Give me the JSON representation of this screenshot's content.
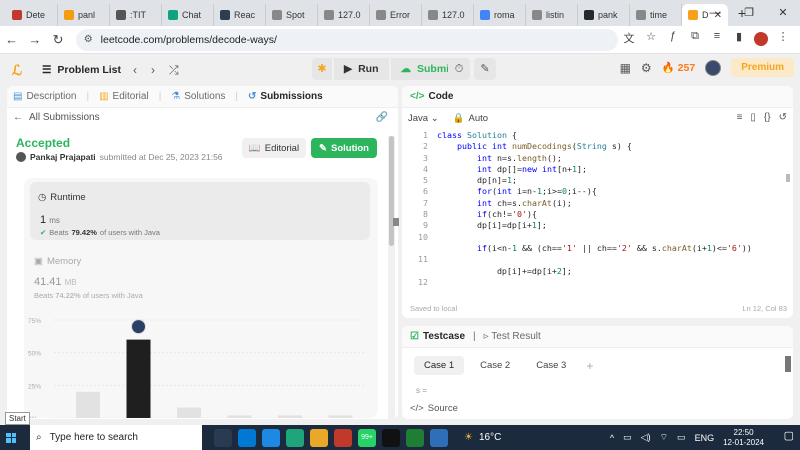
{
  "browser": {
    "tabs": [
      {
        "label": "Dete",
        "color": "#c0392b"
      },
      {
        "label": "panl",
        "color": "#f39c12"
      },
      {
        "label": ":TIT",
        "color": "#555555"
      },
      {
        "label": "Chat",
        "color": "#10a37f"
      },
      {
        "label": "Reac",
        "color": "#2c3e50"
      },
      {
        "label": "Spot",
        "color": "#888888"
      },
      {
        "label": "127.0",
        "color": "#888888"
      },
      {
        "label": "Error",
        "color": "#888888"
      },
      {
        "label": "127.0",
        "color": "#888888"
      },
      {
        "label": "roma",
        "color": "#4285f4"
      },
      {
        "label": "listin",
        "color": "#888888"
      },
      {
        "label": "pank",
        "color": "#24292e"
      },
      {
        "label": "time",
        "color": "#888888"
      }
    ],
    "active_tab": {
      "label": "D"
    },
    "url": "leetcode.com/problems/decode-ways/"
  },
  "lc_nav": {
    "problem_list": "Problem List",
    "run": "Run",
    "submit": "Submit",
    "streak": "257",
    "premium": "Premium",
    "accent": "#2db55d"
  },
  "left": {
    "tabs": [
      {
        "label": "Description",
        "icon": "document-icon"
      },
      {
        "label": "Editorial",
        "icon": "book-icon"
      },
      {
        "label": "Solutions",
        "icon": "flask-icon"
      },
      {
        "label": "Submissions",
        "icon": "history-icon"
      }
    ],
    "all_submissions": "All Submissions",
    "status": "Accepted",
    "author_name": "Pankaj Prajapati",
    "author_text": "submitted at Dec 25, 2023 21:56",
    "editorial_btn": "Editorial",
    "solution_btn": "Solution",
    "runtime": {
      "title": "Runtime",
      "value": "1",
      "unit": "ms",
      "beats_label": "Beats",
      "beats_pct": "79.42%",
      "beats_suffix": "of users with Java"
    },
    "memory": {
      "title": "Memory",
      "value": "41.41",
      "unit": "MB",
      "beats_label": "Beats",
      "beats_pct": "74.22%",
      "beats_suffix": "of users with Java"
    }
  },
  "chart_data": {
    "type": "bar",
    "ylim": [
      0,
      75
    ],
    "yticks": [
      "75%",
      "50%",
      "25%",
      "0%"
    ],
    "values": [
      20,
      60,
      8,
      2,
      2,
      2
    ],
    "highlight_index": 1
  },
  "code_panel": {
    "title": "Code",
    "language": "Java",
    "auto": "Auto",
    "saved": "Saved to local",
    "cursor": "Ln 12, Col 83",
    "lines": [
      {
        "n": "1",
        "html": "<span class='k'>class</span> <span class='t'>Solution</span> {"
      },
      {
        "n": "2",
        "html": "    <span class='k'>public</span> <span class='k'>int</span> <span class='f'>numDecodings</span>(<span class='t'>String</span> s) {"
      },
      {
        "n": "3",
        "html": "        <span class='k'>int</span> n=s.<span class='f'>length</span>();"
      },
      {
        "n": "4",
        "html": "        <span class='k'>int</span> dp[]=<span class='k'>new</span> <span class='k'>int</span>[n+<span class='n'>1</span>];"
      },
      {
        "n": "5",
        "html": "        dp[n]=<span class='n'>1</span>;"
      },
      {
        "n": "6",
        "html": "        <span class='k'>for</span>(<span class='k'>int</span> i=n-<span class='n'>1</span>;i>=<span class='n'>0</span>;i--){"
      },
      {
        "n": "7",
        "html": "        <span class='k'>int</span> ch=s.<span class='f'>charAt</span>(i);"
      },
      {
        "n": "8",
        "html": "        <span class='k'>if</span>(ch!=<span class='s'>'0'</span>){"
      },
      {
        "n": "9",
        "html": "        dp[i]=dp[i+<span class='n'>1</span>];"
      },
      {
        "n": "10",
        "html": ""
      },
      {
        "n": "",
        "html": "        <span class='k'>if</span>(i&lt;n-<span class='n'>1</span> &amp;&amp; (ch==<span class='s'>'1'</span> || ch==<span class='s'>'2'</span> &amp;&amp; s.<span class='f'>charAt</span>(i+<span class='n'>1</span>)&lt;=<span class='s'>'6'</span>))"
      },
      {
        "n": "11",
        "html": ""
      },
      {
        "n": "",
        "html": "            dp[i]+=dp[i+<span class='n'>2</span>];"
      },
      {
        "n": "12",
        "html": ""
      }
    ]
  },
  "test_panel": {
    "tab_testcase": "Testcase",
    "tab_result": "Test Result",
    "cases": [
      "Case 1",
      "Case 2",
      "Case 3"
    ],
    "s_label": "s =",
    "source": "Source"
  },
  "taskbar": {
    "search": "Type here to search",
    "temp": "16°C",
    "lang": "ENG",
    "time": "22:50",
    "date": "12-01-2024",
    "badge": "99+"
  },
  "tooltip": "Start"
}
